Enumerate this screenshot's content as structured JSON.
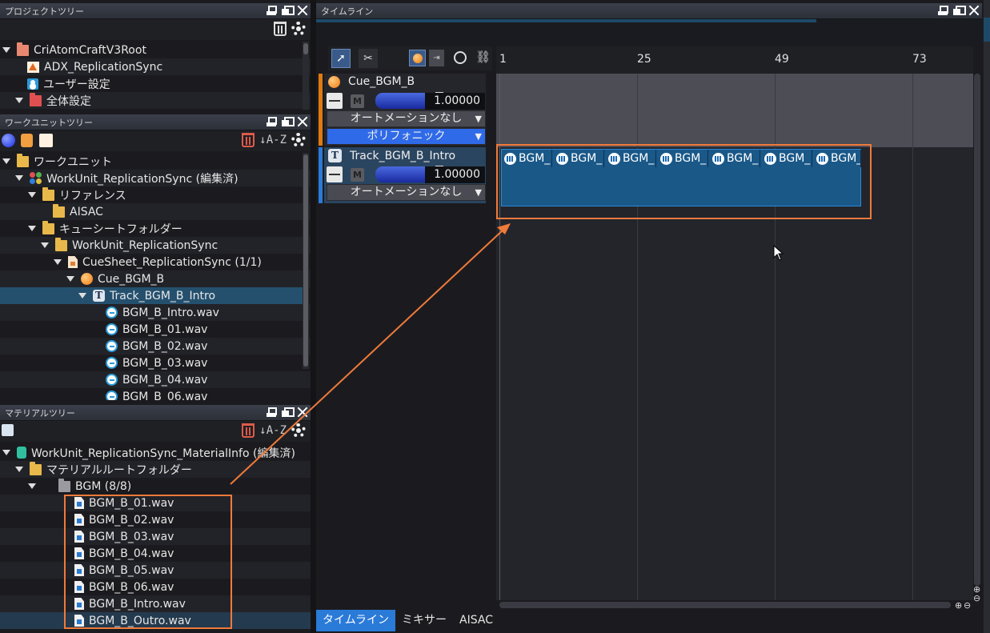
{
  "project_tree": {
    "title": "プロジェクトツリー",
    "items": [
      {
        "label": "CriAtomCraftV3Root"
      },
      {
        "label": "ADX_ReplicationSync"
      },
      {
        "label": "ユーザー設定"
      },
      {
        "label": "全体設定"
      }
    ]
  },
  "workunit_tree": {
    "title": "ワークユニットツリー",
    "items": [
      {
        "label": "ワークユニット"
      },
      {
        "label": "WorkUnit_ReplicationSync (編集済)"
      },
      {
        "label": "リファレンス"
      },
      {
        "label": "AISAC"
      },
      {
        "label": "キューシートフォルダー"
      },
      {
        "label": "WorkUnit_ReplicationSync"
      },
      {
        "label": "CueSheet_ReplicationSync (1/1)"
      },
      {
        "label": "Cue_BGM_B"
      },
      {
        "label": "Track_BGM_B_Intro"
      },
      {
        "label": "BGM_B_Intro.wav"
      },
      {
        "label": "BGM_B_01.wav"
      },
      {
        "label": "BGM_B_02.wav"
      },
      {
        "label": "BGM_B_03.wav"
      },
      {
        "label": "BGM_B_04.wav"
      },
      {
        "label": "BGM_B_06.wav"
      }
    ]
  },
  "material_tree": {
    "title": "マテリアルツリー",
    "items": [
      {
        "label": "WorkUnit_ReplicationSync_MaterialInfo (編集済)"
      },
      {
        "label": "マテリアルルートフォルダー"
      },
      {
        "label": "BGM (8/8)"
      },
      {
        "label": "BGM_B_01.wav"
      },
      {
        "label": "BGM_B_02.wav"
      },
      {
        "label": "BGM_B_03.wav"
      },
      {
        "label": "BGM_B_04.wav"
      },
      {
        "label": "BGM_B_05.wav"
      },
      {
        "label": "BGM_B_06.wav"
      },
      {
        "label": "BGM_B_Intro.wav"
      },
      {
        "label": "BGM_B_Outro.wav"
      }
    ]
  },
  "timeline": {
    "title": "タイムライン",
    "ruler": [
      "1",
      "25",
      "49",
      "73"
    ],
    "cue": {
      "name": "Cue_BGM_B",
      "mute": "M",
      "volume": "1.00000",
      "automation": "オートメーションなし",
      "mode": "ポリフォニック"
    },
    "track": {
      "name": "Track_BGM_B_Intro",
      "mute": "M",
      "volume": "1.00000",
      "automation": "オートメーションなし"
    },
    "clip_label": "BGM_",
    "clips": [
      "BGM_",
      "BGM_",
      "BGM_",
      "BGM_",
      "BGM_",
      "BGM_",
      "BGM_"
    ]
  },
  "tabs": [
    "タイムライン",
    "ミキサー",
    "AISAC"
  ],
  "colors": {
    "accent": "#2a7ad8",
    "highlight": "#f07a3a",
    "selected_row": "#24506e"
  }
}
